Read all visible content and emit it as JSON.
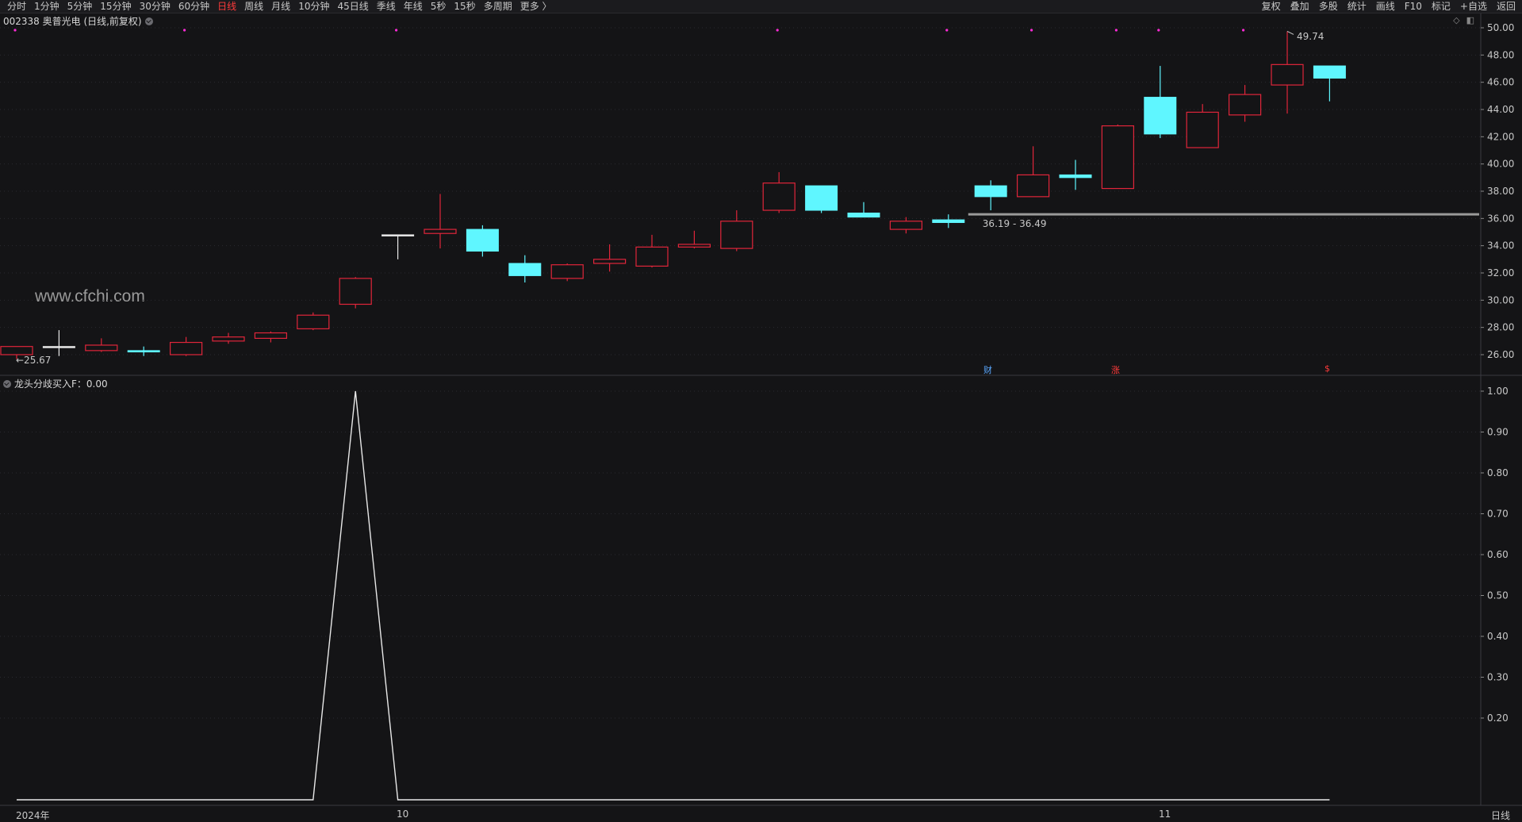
{
  "toolbar": {
    "periods": [
      "分时",
      "1分钟",
      "5分钟",
      "15分钟",
      "30分钟",
      "60分钟",
      "日线",
      "周线",
      "月线",
      "10分钟",
      "45日线",
      "季线",
      "年线",
      "5秒",
      "15秒",
      "多周期",
      "更多 〉"
    ],
    "active_period": "日线",
    "right_items": [
      "复权",
      "叠加",
      "多股",
      "统计",
      "画线",
      "F10",
      "标记",
      "+自选",
      "返回"
    ]
  },
  "main_panel": {
    "title": "002338 奥普光电 (日线,前复权)",
    "watermark": "www.cfchi.com",
    "y_ticks": [
      "50.00",
      "48.00",
      "46.00",
      "44.00",
      "42.00",
      "40.00",
      "38.00",
      "36.00",
      "34.00",
      "32.00",
      "30.00",
      "28.00",
      "26.00"
    ],
    "low_label": "←25.67",
    "high_label": "49.74",
    "range_label": "36.19 - 36.49",
    "badges": [
      {
        "text": "财",
        "color": "#5aa8ff"
      },
      {
        "text": "涨",
        "color": "#ff3b3b"
      },
      {
        "text": "$",
        "color": "#ff3b3b"
      }
    ]
  },
  "indicator_panel": {
    "title": "龙头分歧买入F：0.00",
    "y_ticks": [
      "1.00",
      "0.90",
      "0.80",
      "0.70",
      "0.60",
      "0.50",
      "0.40",
      "0.30",
      "0.20"
    ]
  },
  "x_axis": {
    "labels": [
      "2024年",
      "10",
      "11"
    ],
    "period_label": "日线"
  },
  "colors": {
    "up": "#e0253a",
    "down": "#5ff6ff",
    "flat": "#e8e8e8",
    "signal_dot": "#ff2bd6",
    "indicator_line": "#e8e8e8",
    "support_line": "#9a9a9a"
  },
  "chart_data": [
    {
      "type": "candlestick",
      "title": "002338 奥普光电 (日线,前复权)",
      "ylim": [
        25,
        50.5
      ],
      "candles": [
        {
          "o": 26.0,
          "h": 26.6,
          "l": 25.67,
          "c": 26.6
        },
        {
          "o": 26.6,
          "h": 27.8,
          "l": 25.9,
          "c": 26.6
        },
        {
          "o": 26.3,
          "h": 27.2,
          "l": 26.2,
          "c": 26.7
        },
        {
          "o": 26.3,
          "h": 26.6,
          "l": 25.9,
          "c": 26.2
        },
        {
          "o": 26.0,
          "h": 27.3,
          "l": 25.9,
          "c": 26.9
        },
        {
          "o": 27.0,
          "h": 27.6,
          "l": 26.8,
          "c": 27.3
        },
        {
          "o": 27.2,
          "h": 27.7,
          "l": 26.9,
          "c": 27.6
        },
        {
          "o": 27.9,
          "h": 29.1,
          "l": 27.8,
          "c": 28.9
        },
        {
          "o": 29.7,
          "h": 31.7,
          "l": 29.4,
          "c": 31.6
        },
        {
          "o": 34.8,
          "h": 34.8,
          "l": 33.0,
          "c": 34.8
        },
        {
          "o": 34.9,
          "h": 37.8,
          "l": 33.8,
          "c": 35.2
        },
        {
          "o": 35.2,
          "h": 35.5,
          "l": 33.2,
          "c": 33.6
        },
        {
          "o": 32.7,
          "h": 33.3,
          "l": 31.3,
          "c": 31.8
        },
        {
          "o": 31.6,
          "h": 32.7,
          "l": 31.4,
          "c": 32.6
        },
        {
          "o": 32.7,
          "h": 34.1,
          "l": 32.1,
          "c": 33.0
        },
        {
          "o": 32.5,
          "h": 34.8,
          "l": 32.4,
          "c": 33.9
        },
        {
          "o": 33.9,
          "h": 35.1,
          "l": 33.8,
          "c": 34.1
        },
        {
          "o": 33.8,
          "h": 36.6,
          "l": 33.6,
          "c": 35.8
        },
        {
          "o": 36.6,
          "h": 39.4,
          "l": 36.4,
          "c": 38.6
        },
        {
          "o": 38.4,
          "h": 38.4,
          "l": 36.4,
          "c": 36.6
        },
        {
          "o": 36.4,
          "h": 37.2,
          "l": 36.1,
          "c": 36.1
        },
        {
          "o": 35.2,
          "h": 36.1,
          "l": 34.9,
          "c": 35.8
        },
        {
          "o": 35.9,
          "h": 36.3,
          "l": 35.3,
          "c": 35.7
        },
        {
          "o": 38.4,
          "h": 38.8,
          "l": 36.6,
          "c": 37.6
        },
        {
          "o": 37.6,
          "h": 41.3,
          "l": 37.6,
          "c": 39.2
        },
        {
          "o": 39.2,
          "h": 40.3,
          "l": 38.1,
          "c": 39.0
        },
        {
          "o": 38.2,
          "h": 42.9,
          "l": 38.2,
          "c": 42.8
        },
        {
          "o": 44.9,
          "h": 47.2,
          "l": 41.9,
          "c": 42.2
        },
        {
          "o": 41.2,
          "h": 44.4,
          "l": 41.2,
          "c": 43.8
        },
        {
          "o": 43.6,
          "h": 45.8,
          "l": 43.1,
          "c": 45.1
        },
        {
          "o": 45.8,
          "h": 49.74,
          "l": 43.7,
          "c": 47.3
        },
        {
          "o": 47.2,
          "h": 47.2,
          "l": 44.6,
          "c": 46.3
        }
      ],
      "signal_marks": [
        0,
        4,
        9,
        18,
        22,
        24,
        26,
        27,
        29
      ],
      "support_line": {
        "value": 36.3,
        "from_index": 22
      },
      "y_ticks": [
        50,
        48,
        46,
        44,
        42,
        40,
        38,
        36,
        34,
        32,
        30,
        28,
        26
      ]
    },
    {
      "type": "line",
      "title": "龙头分歧买入F：0.00",
      "ylim": [
        0,
        1.0
      ],
      "values": [
        0,
        0,
        0,
        0,
        0,
        0,
        0,
        0,
        1,
        0,
        0,
        0,
        0,
        0,
        0,
        0,
        0,
        0,
        0,
        0,
        0,
        0,
        0,
        0,
        0,
        0,
        0,
        0,
        0,
        0,
        0,
        0
      ],
      "y_ticks": [
        1.0,
        0.9,
        0.8,
        0.7,
        0.6,
        0.5,
        0.4,
        0.3,
        0.2
      ]
    }
  ]
}
